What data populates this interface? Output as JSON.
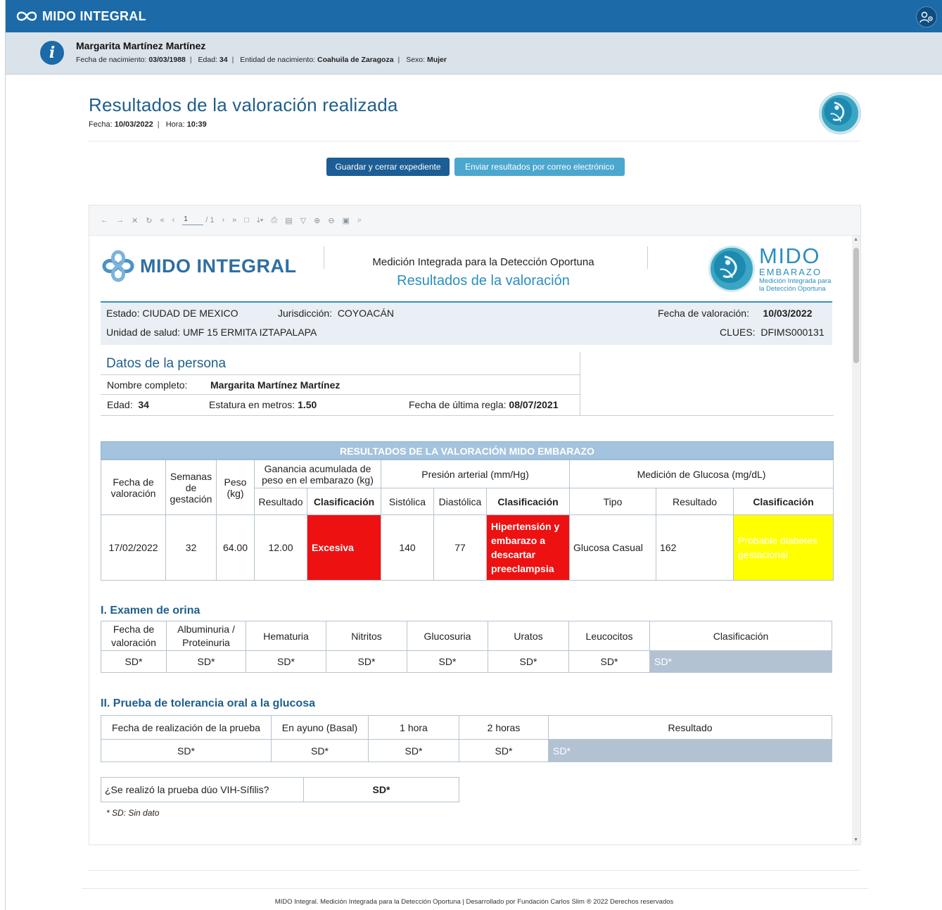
{
  "app": {
    "title": "MIDO INTEGRAL"
  },
  "patient": {
    "name": "Margarita Martínez Martínez",
    "dob_label": "Fecha de nacimiento:",
    "dob": "03/03/1988",
    "age_label": "Edad:",
    "age": "34",
    "entity_label": "Entidad de nacimiento:",
    "entity": "Coahuila de Zaragoza",
    "sex_label": "Sexo:",
    "sex": "Mujer"
  },
  "page": {
    "title": "Resultados de la valoración realizada",
    "date_label": "Fecha:",
    "date": "10/03/2022",
    "time_label": "Hora:",
    "time": "10:39"
  },
  "buttons": {
    "save": "Guardar y cerrar expediente",
    "email": "Enviar resultados por correo electrónico"
  },
  "viewer": {
    "page_current": "1",
    "page_total": "/ 1"
  },
  "report": {
    "logo_text": "MIDO INTEGRAL",
    "header_line1": "Medición Integrada para la Detección Oportuna",
    "header_line2": "Resultados de la valoración",
    "emb_big": "MIDO",
    "emb_mid": "EMBARAZO",
    "emb_small1": "Medición Integrada para",
    "emb_small2": "la Detección Oportuna",
    "estado_label": "Estado:",
    "estado": "CIUDAD DE MEXICO",
    "juris_label": "Jurisdicción:",
    "juris": "COYOACÁN",
    "fecha_val_label": "Fecha de valoración:",
    "fecha_val": "10/03/2022",
    "unidad_label": "Unidad de salud:",
    "unidad": "UMF 15 ERMITA IZTAPALAPA",
    "clues_label": "CLUES:",
    "clues": "DFIMS000131",
    "datos_title": "Datos de la persona",
    "nombre_label": "Nombre completo:",
    "nombre": "Margarita Martínez Martínez",
    "edad_label": "Edad:",
    "edad": "34",
    "estatura_label": "Estatura en metros:",
    "estatura": "1.50",
    "fur_label": "Fecha de última regla:",
    "fur": "08/07/2021",
    "results_title": "RESULTADOS DE LA VALORACIÓN MIDO EMBARAZO",
    "results_headers": {
      "fecha": "Fecha de valoración",
      "semanas": "Semanas de gestación",
      "peso": "Peso (kg)",
      "ganancia": "Ganancia acumulada de peso en el embarazo (kg)",
      "presion": "Presión arterial (mm/Hg)",
      "glucosa": "Medición de Glucosa (mg/dL)",
      "resultado": "Resultado",
      "clasificacion": "Clasificación",
      "sistolica": "Sistólica",
      "diastolica": "Diastólica",
      "tipo": "Tipo"
    },
    "results_row": {
      "fecha": "17/02/2022",
      "semanas": "32",
      "peso": "64.00",
      "ganancia": "12.00",
      "ganancia_cls": "Excesiva",
      "sistolica": "140",
      "diastolica": "77",
      "presion_cls": "Hipertensión y embarazo a descartar preeclampsia",
      "glucosa_tipo": "Glucosa Casual",
      "glucosa_res": "162",
      "glucosa_cls": "Probable diabetes gestacional"
    },
    "orina_title": "I. Examen de orina",
    "orina_headers": [
      "Fecha de valoración",
      "Albuminuria / Proteinuria",
      "Hematuria",
      "Nitritos",
      "Glucosuria",
      "Uratos",
      "Leucocitos",
      "Clasificación"
    ],
    "orina_values": [
      "SD*",
      "SD*",
      "SD*",
      "SD*",
      "SD*",
      "SD*",
      "SD*",
      "SD*"
    ],
    "ptog_title": "II. Prueba de tolerancia oral a la glucosa",
    "ptog_headers": [
      "Fecha de realización de la prueba",
      "En ayuno (Basal)",
      "1 hora",
      "2 horas",
      "Resultado"
    ],
    "ptog_values": [
      "SD*",
      "SD*",
      "SD*",
      "SD*",
      "SD*"
    ],
    "vih_label": "¿Se realizó la prueba dúo VIH-Sífilis?",
    "vih_value": "SD*",
    "footnote": "* SD: Sin dato"
  },
  "footer": "MIDO Integral. Medición Integrada para la Detección Oportuna | Desarrollado por Fundación Carlos Slim ® 2022 Derechos reservados",
  "colors": {
    "brand": "#1c6aa8",
    "accent": "#4ca7cf",
    "alert_red": "#ee1111",
    "alert_yellow": "#ffff00"
  }
}
